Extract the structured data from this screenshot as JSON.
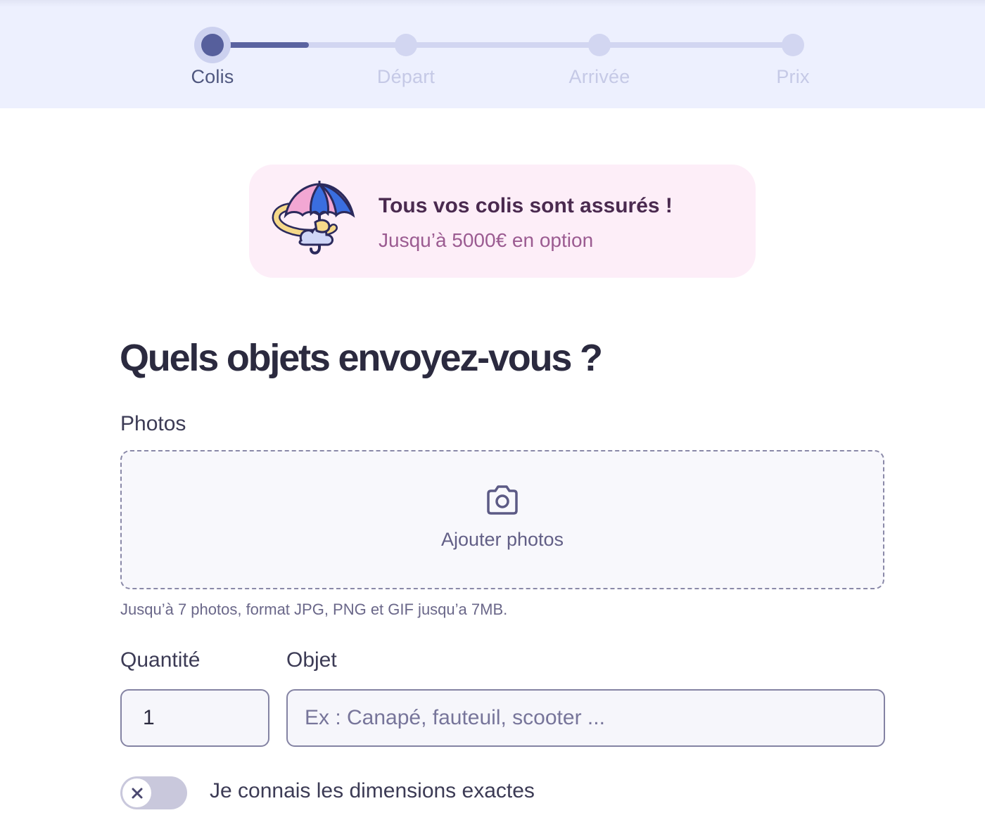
{
  "stepper": {
    "steps": [
      {
        "label": "Colis",
        "state": "active"
      },
      {
        "label": "Départ",
        "state": "upcoming"
      },
      {
        "label": "Arrivée",
        "state": "upcoming"
      },
      {
        "label": "Prix",
        "state": "upcoming"
      }
    ],
    "progress_within_first_segment": 0.5
  },
  "promo": {
    "icon": "umbrella-illustration",
    "title": "Tous vos colis sont assurés !",
    "subtitle": "Jusqu’à 5000€ en option"
  },
  "form": {
    "heading": "Quels objets envoyez-vous ?",
    "photos": {
      "label": "Photos",
      "icon": "camera-icon",
      "button_label": "Ajouter photos",
      "hint": "Jusqu’à 7 photos, format JPG, PNG et GIF jusqu’a 7MB."
    },
    "quantity": {
      "label": "Quantité",
      "value": "1"
    },
    "object": {
      "label": "Objet",
      "placeholder": "Ex : Canapé, fauteuil, scooter ..."
    },
    "dimensions_toggle": {
      "label": "Je connais les dimensions exactes",
      "checked": false
    }
  },
  "colors": {
    "stepper_bg": "#edf0fe",
    "accent": "#565f9c",
    "promo_bg": "#fdeef8",
    "text_dark": "#2b2a3f"
  }
}
